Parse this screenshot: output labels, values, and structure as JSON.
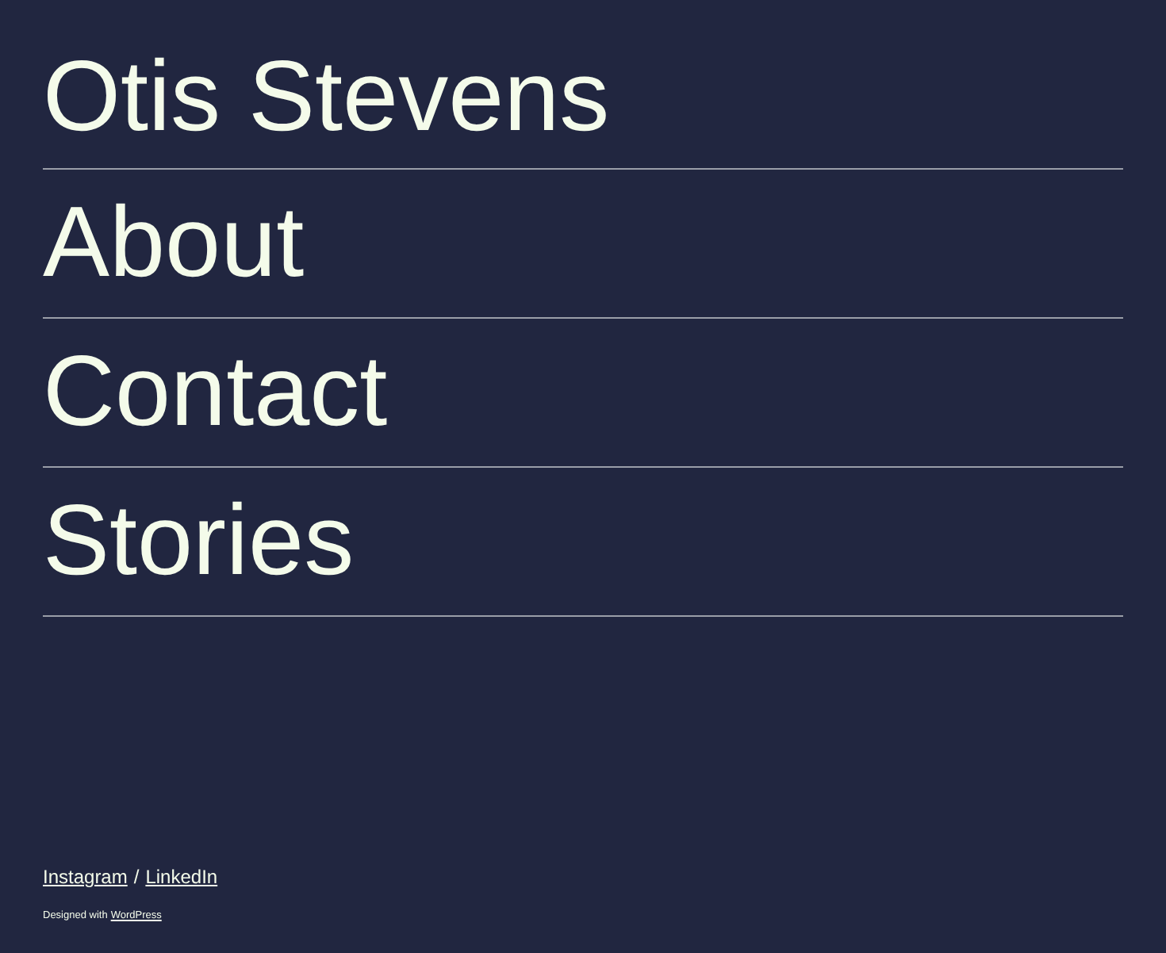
{
  "site_title": "Otis Stevens",
  "nav": [
    {
      "label": "About"
    },
    {
      "label": "Contact"
    },
    {
      "label": "Stories"
    }
  ],
  "social_links": [
    "Instagram",
    "LinkedIn"
  ],
  "social_separator": "/",
  "credit": {
    "text": "Designed with",
    "link": "WordPress"
  }
}
